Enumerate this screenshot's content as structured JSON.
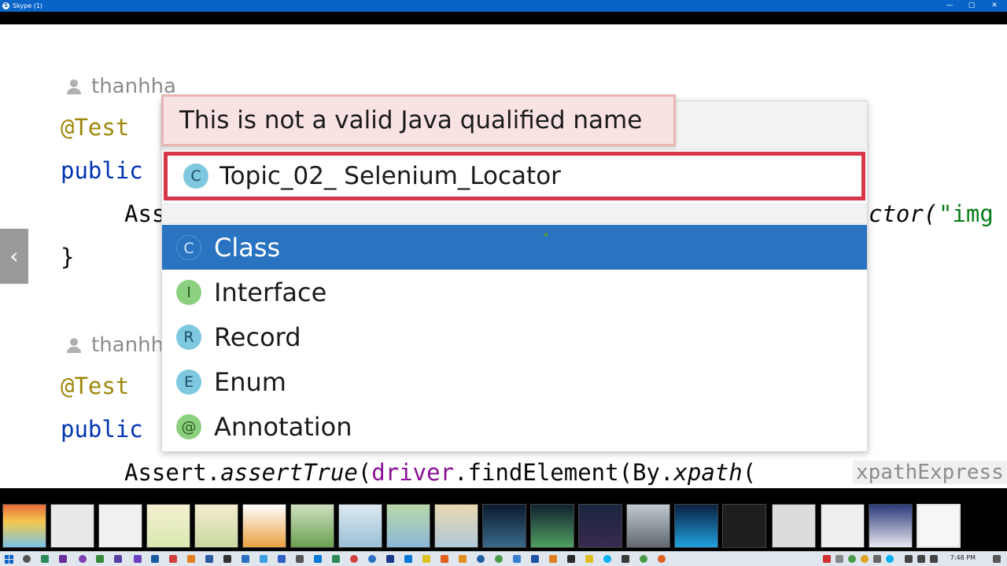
{
  "window": {
    "title": "Skype (1)",
    "logo": "S",
    "minimize_icon": "—",
    "maximize_icon": "▢",
    "close_icon": "✕"
  },
  "editor": {
    "author1": "thanhha",
    "annotation1": "@Test",
    "keyword1": "public",
    "assert_fragment": "Ass",
    "selector_fragment": "ctor(",
    "string_fragment": "\"img",
    "closing_brace": "}",
    "author2": "thanhh",
    "annotation2": "@Test",
    "keyword2": "public",
    "line_assert": "Assert.",
    "line_method": "assertTrue",
    "line_paren": "(",
    "line_driver": "driver",
    "line_find": ".findElement(By.",
    "line_xpath": "xpath",
    "line_paren2": "(",
    "param_hint": "xpathExpress"
  },
  "nav": {
    "prev_icon": "‹"
  },
  "dialog": {
    "error_message": "This is not a valid Java qualified name",
    "name_value": "Topic_02_ Selenium_Locator",
    "name_badge": "C",
    "kinds": [
      {
        "badge": "C",
        "label": "Class",
        "selected": true
      },
      {
        "badge": "I",
        "label": "Interface",
        "selected": false
      },
      {
        "badge": "R",
        "label": "Record",
        "selected": false
      },
      {
        "badge": "E",
        "label": "Enum",
        "selected": false
      },
      {
        "badge": "@",
        "label": "Annotation",
        "selected": false
      }
    ]
  },
  "taskbar": {
    "clock": "7:48 PM"
  },
  "colors": {
    "selection": "#2a73c1",
    "error_border": "#d8374a",
    "error_bg": "#f9e3e2",
    "title_bar": "#0a64c8"
  }
}
